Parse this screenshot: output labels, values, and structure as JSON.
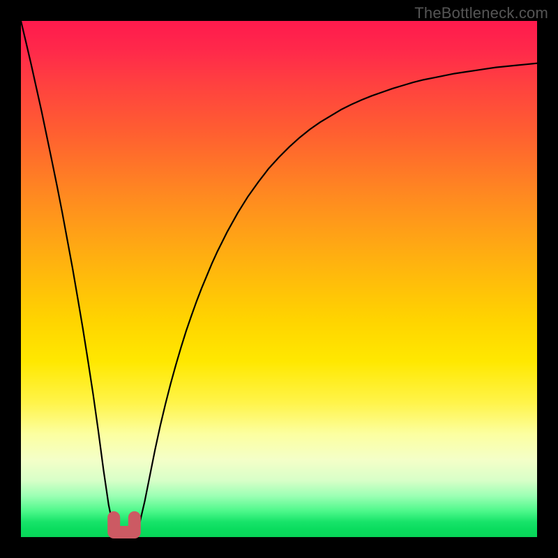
{
  "watermark": "TheBottleneck.com",
  "colors": {
    "frame": "#000000",
    "gradient_top": "#ff1a4d",
    "gradient_bottom": "#08d658",
    "curve": "#000000",
    "marker_stroke": "#cd5c5c",
    "marker_fill": "#cd5c5c"
  },
  "chart_data": {
    "type": "line",
    "title": "",
    "xlabel": "",
    "ylabel": "",
    "xlim": [
      0,
      100
    ],
    "ylim": [
      0,
      100
    ],
    "x": [
      0,
      1,
      2,
      3,
      4,
      5,
      6,
      7,
      8,
      9,
      10,
      11,
      12,
      13,
      14,
      15,
      16,
      17,
      18,
      19,
      20,
      21,
      22,
      23,
      24,
      25,
      26,
      27,
      28,
      29,
      30,
      31,
      32,
      33,
      34,
      35,
      36,
      37,
      38,
      39,
      40,
      42,
      44,
      46,
      48,
      50,
      52,
      54,
      56,
      58,
      60,
      62,
      64,
      66,
      68,
      70,
      72,
      74,
      76,
      78,
      80,
      82,
      84,
      86,
      88,
      90,
      92,
      94,
      96,
      98,
      100
    ],
    "y": [
      100,
      95.8,
      91.5,
      87,
      82.5,
      77.7,
      72.9,
      68,
      62.9,
      57.5,
      52.1,
      46.3,
      40.4,
      34.1,
      27.6,
      20.5,
      13.0,
      6.2,
      1.4,
      0,
      0,
      0,
      0.3,
      2.7,
      7.0,
      12.0,
      17.0,
      21.6,
      25.8,
      29.7,
      33.3,
      36.7,
      39.9,
      42.8,
      45.6,
      48.2,
      50.6,
      53.0,
      55.2,
      57.2,
      59.2,
      62.8,
      66.0,
      68.8,
      71.4,
      73.6,
      75.6,
      77.4,
      79.0,
      80.4,
      81.6,
      82.8,
      83.8,
      84.7,
      85.5,
      86.2,
      86.9,
      87.5,
      88.1,
      88.6,
      89.0,
      89.4,
      89.8,
      90.1,
      90.4,
      90.7,
      91.0,
      91.2,
      91.4,
      91.6,
      91.8
    ],
    "marker_region": {
      "x_start": 18,
      "x_end": 22,
      "description": "flat-bottom minimum segment highlighted with wide rounded pink stroke"
    }
  }
}
